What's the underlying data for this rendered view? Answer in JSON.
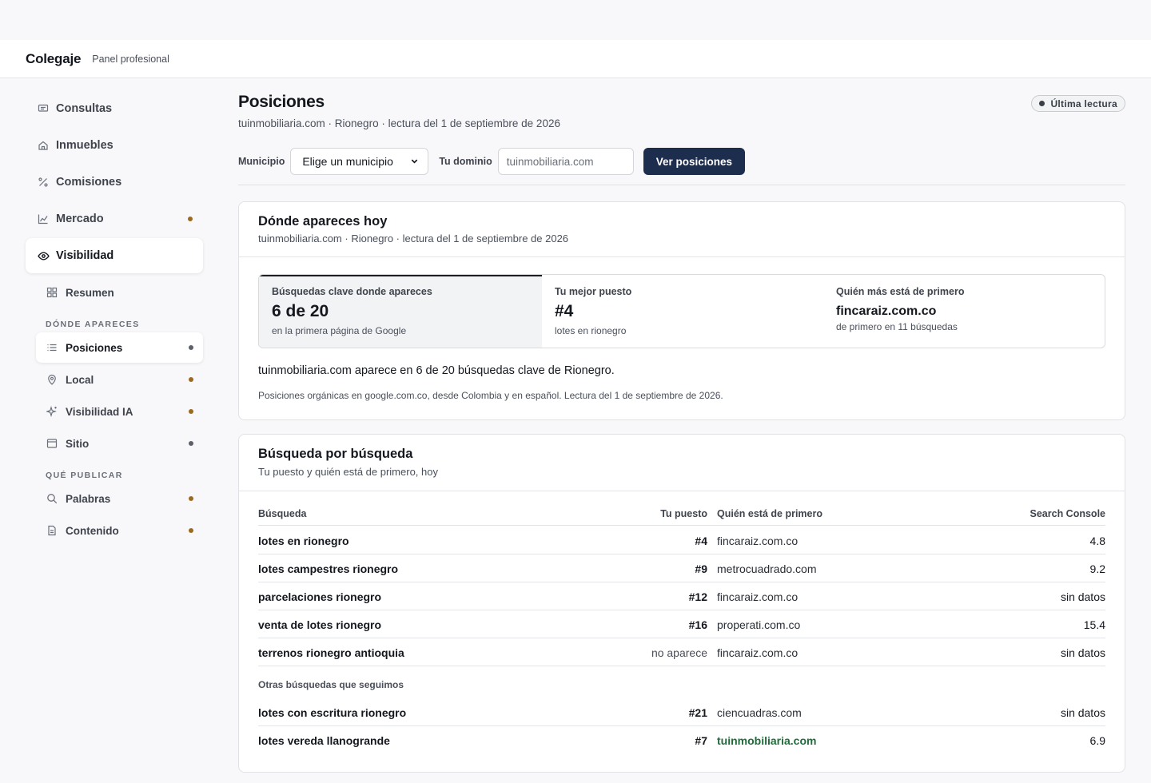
{
  "header": {
    "brand": "Colegaje",
    "subtitle": "Panel profesional"
  },
  "sidebar": {
    "items": [
      {
        "label": "Consultas",
        "icon": "message-icon"
      },
      {
        "label": "Inmuebles",
        "icon": "home-icon"
      },
      {
        "label": "Comisiones",
        "icon": "percent-icon"
      },
      {
        "label": "Mercado",
        "icon": "chart-icon",
        "dot": "amber"
      },
      {
        "label": "Visibilidad",
        "icon": "eye-icon",
        "active": true
      }
    ],
    "resumen": {
      "label": "Resumen",
      "icon": "grid-icon"
    },
    "section_donde": "DÓNDE APARECES",
    "donde_items": [
      {
        "label": "Posiciones",
        "icon": "list-icon",
        "dot": "gray",
        "active": true
      },
      {
        "label": "Local",
        "icon": "pin-icon",
        "dot": "amber"
      },
      {
        "label": "Visibilidad IA",
        "icon": "sparkle-icon",
        "dot": "amber"
      },
      {
        "label": "Sitio",
        "icon": "window-icon",
        "dot": "gray"
      }
    ],
    "section_publicar": "QUÉ PUBLICAR",
    "publicar_items": [
      {
        "label": "Palabras",
        "icon": "search-icon",
        "dot": "amber"
      },
      {
        "label": "Contenido",
        "icon": "document-icon",
        "dot": "amber"
      }
    ]
  },
  "page": {
    "title": "Posiciones",
    "subtitle": "tuinmobiliaria.com · Rionegro · lectura del 1 de septiembre de 2026",
    "badge": "Última lectura"
  },
  "filters": {
    "municipio_label": "Municipio",
    "municipio_value": "Elige un municipio",
    "dominio_label": "Tu dominio",
    "dominio_value": "tuinmobiliaria.com",
    "button": "Ver posiciones"
  },
  "overview": {
    "title": "Dónde apareces hoy",
    "subtitle": "tuinmobiliaria.com · Rionegro · lectura del 1 de septiembre de 2026",
    "stats": [
      {
        "label": "Búsquedas clave donde apareces",
        "value": "6 de 20",
        "note": "en la primera página de Google"
      },
      {
        "label": "Tu mejor puesto",
        "value": "#4",
        "note": "lotes en rionegro"
      },
      {
        "label": "Quién más está de primero",
        "value": "fincaraiz.com.co",
        "note": "de primero en 11 búsquedas"
      }
    ],
    "summary": "tuinmobiliaria.com aparece en 6 de 20 búsquedas clave de Rionegro.",
    "footnote": "Posiciones orgánicas en google.com.co, desde Colombia y en español. Lectura del 1 de septiembre de 2026."
  },
  "table": {
    "title": "Búsqueda por búsqueda",
    "subtitle": "Tu puesto y quién está de primero, hoy",
    "columns": {
      "query": "Búsqueda",
      "position": "Tu puesto",
      "leader": "Quién está de primero",
      "console": "Search Console"
    },
    "rows": [
      {
        "query": "lotes en rionegro",
        "position": "#4",
        "leader": "fincaraiz.com.co",
        "console": "4.8"
      },
      {
        "query": "lotes campestres rionegro",
        "position": "#9",
        "leader": "metrocuadrado.com",
        "console": "9.2"
      },
      {
        "query": "parcelaciones rionegro",
        "position": "#12",
        "leader": "fincaraiz.com.co",
        "console": "sin datos"
      },
      {
        "query": "venta de lotes rionegro",
        "position": "#16",
        "leader": "properati.com.co",
        "console": "15.4"
      },
      {
        "query": "terrenos rionegro antioquia",
        "position": "no aparece",
        "leader": "fincaraiz.com.co",
        "console": "sin datos"
      }
    ],
    "other_label": "Otras búsquedas que seguimos",
    "other_rows": [
      {
        "query": "lotes con escritura rionegro",
        "position": "#21",
        "leader": "ciencuadras.com",
        "console": "sin datos"
      },
      {
        "query": "lotes vereda llanogrande",
        "position": "#7",
        "leader": "tuinmobiliaria.com",
        "console": "6.9"
      }
    ]
  },
  "colors": {
    "primary": "#1d2d4e",
    "amber_dot": "#9c6a1d",
    "self_domain": "#1f6b3a"
  }
}
